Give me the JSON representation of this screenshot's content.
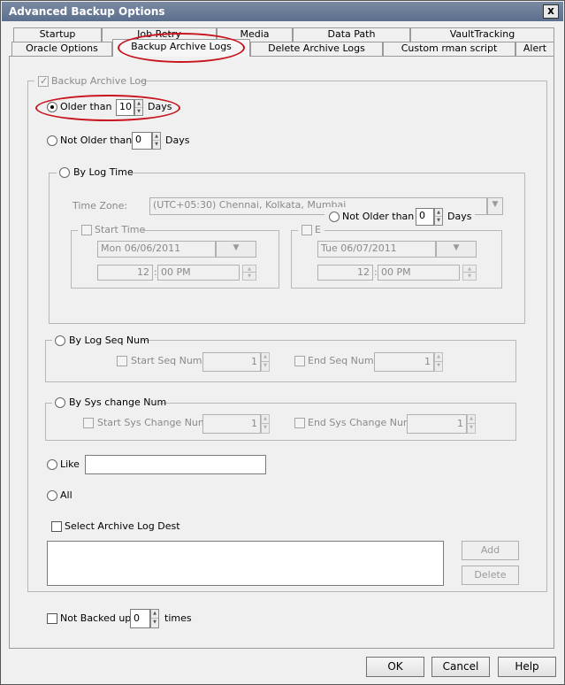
{
  "window": {
    "title": "Advanced Backup Options",
    "close_glyph": "x"
  },
  "tabs": {
    "row1": [
      "Startup",
      "Job Retry",
      "Media",
      "Data Path",
      "VaultTracking"
    ],
    "row2": [
      "Oracle Options",
      "Backup Archive Logs",
      "Delete Archive Logs",
      "Custom rman script",
      "Alert"
    ],
    "active": "Backup Archive Logs"
  },
  "backup_archive_log": {
    "label": "Backup Archive Log",
    "checked": true
  },
  "older_than": {
    "label": "Older than",
    "value": "10",
    "unit": "Days"
  },
  "not_older_than": {
    "label": "Not Older than",
    "value": "0",
    "unit": "Days"
  },
  "by_log_time": {
    "label": "By Log Time",
    "time_zone_label": "Time Zone:",
    "time_zone_value": "(UTC+05:30) Chennai, Kolkata, Mumbai",
    "inner_not_older_than": {
      "label": "Not Older than",
      "value": "0",
      "unit": "Days"
    },
    "start_time": {
      "label": "Start Time",
      "date": "Mon 06/06/2011",
      "hour": "12",
      "minute": "00 PM"
    },
    "end_time": {
      "label": "E",
      "date": "Tue 06/07/2011",
      "hour": "12",
      "minute": "00 PM"
    }
  },
  "by_log_seq_num": {
    "label": "By Log Seq Num",
    "start_label": "Start Seq Num",
    "start_value": "1",
    "end_label": "End Seq Num",
    "end_value": "1"
  },
  "by_sys_change_num": {
    "label": "By Sys change Num",
    "start_label": "Start Sys Change Num",
    "start_value": "1",
    "end_label": "End Sys Change Num",
    "end_value": "1"
  },
  "like": {
    "label": "Like",
    "value": ""
  },
  "all": {
    "label": "All"
  },
  "select_archive_log_dest": {
    "label": "Select Archive Log Dest",
    "add_label": "Add",
    "delete_label": "Delete"
  },
  "not_backed_up": {
    "label": "Not Backed up",
    "value": "0",
    "unit": "times"
  },
  "footer": {
    "ok": "OK",
    "cancel": "Cancel",
    "help": "Help"
  },
  "colors": {
    "highlight_ring": "#c8141e"
  }
}
